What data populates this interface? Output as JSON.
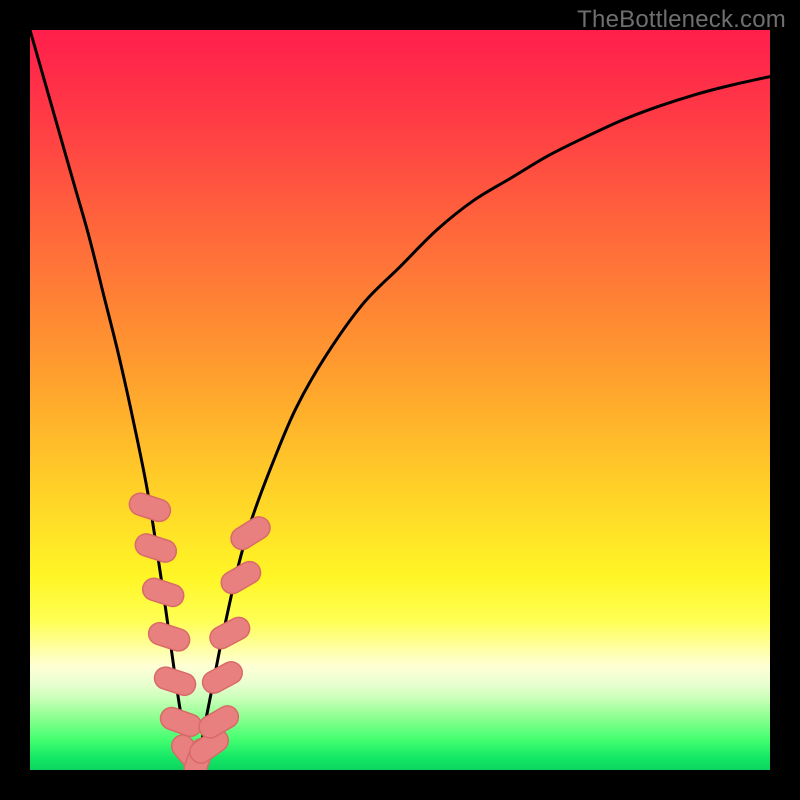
{
  "watermark": {
    "text": "TheBottleneck.com"
  },
  "colors": {
    "black": "#000000",
    "curve": "#000000",
    "marker_fill": "#e8807f",
    "marker_stroke": "#d96a69",
    "gradient_stops": [
      {
        "pct": 0.0,
        "color": "#ff1f4c"
      },
      {
        "pct": 0.12,
        "color": "#ff3b45"
      },
      {
        "pct": 0.28,
        "color": "#ff6a3a"
      },
      {
        "pct": 0.45,
        "color": "#ff9a2f"
      },
      {
        "pct": 0.6,
        "color": "#ffca28"
      },
      {
        "pct": 0.74,
        "color": "#fff626"
      },
      {
        "pct": 0.8,
        "color": "#ffff55"
      },
      {
        "pct": 0.835,
        "color": "#ffffa0"
      },
      {
        "pct": 0.86,
        "color": "#ffffd4"
      },
      {
        "pct": 0.885,
        "color": "#e8ffd0"
      },
      {
        "pct": 0.905,
        "color": "#c8ffb8"
      },
      {
        "pct": 0.93,
        "color": "#8dff90"
      },
      {
        "pct": 0.96,
        "color": "#44ff70"
      },
      {
        "pct": 0.985,
        "color": "#14e765"
      },
      {
        "pct": 1.0,
        "color": "#0ed560"
      }
    ]
  },
  "chart_data": {
    "type": "line",
    "title": "",
    "xlabel": "",
    "ylabel": "",
    "xlim": [
      0,
      100
    ],
    "ylim": [
      0,
      100
    ],
    "notch_x": 22,
    "series": [
      {
        "name": "bottleneck-curve",
        "x": [
          0,
          2,
          4,
          6,
          8,
          10,
          12,
          14,
          16,
          18,
          19,
          20,
          21,
          22,
          23,
          24,
          25,
          26,
          28,
          30,
          33,
          36,
          40,
          45,
          50,
          55,
          60,
          65,
          70,
          75,
          80,
          85,
          90,
          95,
          100
        ],
        "y": [
          100,
          93,
          86,
          79,
          72,
          64,
          56,
          47,
          37,
          24,
          17,
          10,
          4,
          0,
          3,
          8,
          13,
          18,
          27,
          34,
          42,
          49,
          56,
          63,
          68,
          73,
          77,
          80,
          83,
          85.5,
          87.8,
          89.7,
          91.3,
          92.6,
          93.7
        ]
      }
    ],
    "markers": {
      "name": "highlighted-points",
      "points": [
        {
          "x": 16.2,
          "y": 35.5,
          "rot": -72
        },
        {
          "x": 17.0,
          "y": 30.0,
          "rot": -72
        },
        {
          "x": 18.0,
          "y": 24.0,
          "rot": -72
        },
        {
          "x": 18.8,
          "y": 18.0,
          "rot": -72
        },
        {
          "x": 19.6,
          "y": 12.0,
          "rot": -72
        },
        {
          "x": 20.4,
          "y": 6.5,
          "rot": -70
        },
        {
          "x": 21.5,
          "y": 2.2,
          "rot": -40
        },
        {
          "x": 22.8,
          "y": 1.5,
          "rot": 20
        },
        {
          "x": 24.2,
          "y": 3.2,
          "rot": 55
        },
        {
          "x": 25.5,
          "y": 6.5,
          "rot": 60
        },
        {
          "x": 26.0,
          "y": 12.5,
          "rot": 62
        },
        {
          "x": 27.0,
          "y": 18.5,
          "rot": 62
        },
        {
          "x": 28.5,
          "y": 26.0,
          "rot": 60
        },
        {
          "x": 29.8,
          "y": 32.0,
          "rot": 58
        }
      ]
    }
  }
}
